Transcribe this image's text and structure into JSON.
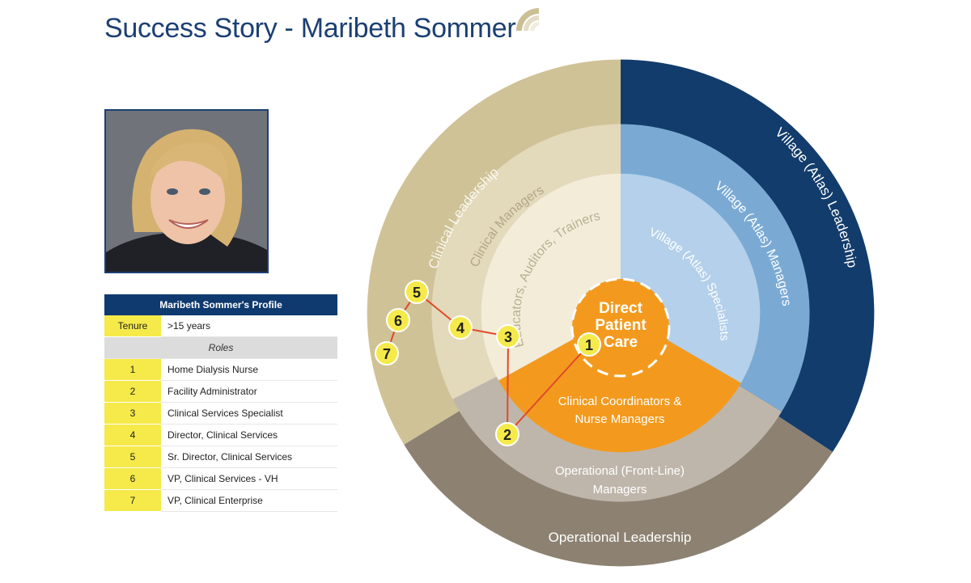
{
  "header": {
    "title": "Success Story - Maribeth Sommer"
  },
  "photo": {
    "alt": "Portrait of Maribeth Sommer"
  },
  "profile": {
    "heading": "Maribeth Sommer's Profile",
    "tenure_label": "Tenure",
    "tenure_value": ">15 years",
    "roles_label": "Roles",
    "roles": [
      {
        "num": "1",
        "title": "Home Dialysis Nurse"
      },
      {
        "num": "2",
        "title": "Facility Administrator"
      },
      {
        "num": "3",
        "title": "Clinical Services Specialist"
      },
      {
        "num": "4",
        "title": "Director, Clinical Services"
      },
      {
        "num": "5",
        "title": "Sr. Director, Clinical Services"
      },
      {
        "num": "6",
        "title": "VP, Clinical Services - VH"
      },
      {
        "num": "7",
        "title": "VP, Clinical Enterprise"
      }
    ]
  },
  "diagram": {
    "center": {
      "line1": "Direct",
      "line2": "Patient",
      "line3": "Care"
    },
    "rings": {
      "clinical_leadership": "Clinical Leadership",
      "clinical_managers": "Clinical Managers",
      "educators": "Educators, Auditors, Trainers",
      "village_leadership": "Village (Atlas) Leadership",
      "village_managers": "Village (Atlas) Managers",
      "village_specialists": "Village (Atlas) Specialists",
      "coordinators_1": "Clinical Coordinators &",
      "coordinators_2": "Nurse Managers",
      "ops_managers_1": "Operational (Front-Line)",
      "ops_managers_2": "Managers",
      "ops_leadership": "Operational Leadership"
    },
    "markers": [
      "1",
      "2",
      "3",
      "4",
      "5",
      "6",
      "7"
    ],
    "colors": {
      "clinical_outer": "#cfc296",
      "clinical_mid": "#e3d9bb",
      "clinical_inner": "#f2ecd9",
      "village_outer": "#123c6b",
      "village_mid": "#7aaad4",
      "village_inner": "#b4d0ea",
      "ops_outer": "#8d8272",
      "ops_mid": "#bfb6ab",
      "coordinators": "#f39a1e",
      "center": "#f39a1e",
      "marker": "#f5ea4a",
      "path": "#e04a2a",
      "title": "#1b3f73",
      "table_header": "#0f3a6f"
    }
  }
}
